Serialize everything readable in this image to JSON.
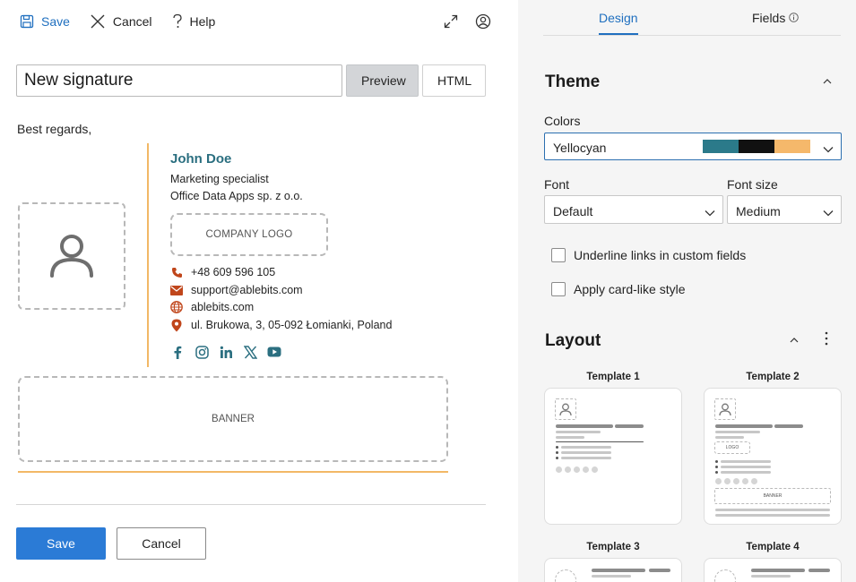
{
  "toolbar": {
    "save_label": "Save",
    "cancel_label": "Cancel",
    "help_label": "Help"
  },
  "editor": {
    "signature_name": "New signature",
    "preview_label": "Preview",
    "html_label": "HTML",
    "greeting": "Best regards,"
  },
  "signature": {
    "name": "John Doe",
    "title": "Marketing specialist",
    "company": "Office Data Apps sp. z o.o.",
    "logo_placeholder": "COMPANY LOGO",
    "phone": "+48 609 596 105",
    "email": "support@ablebits.com",
    "website": "ablebits.com",
    "address": "ul. Brukowa, 3, 05-092 Łomianki, Poland",
    "banner_placeholder": "BANNER",
    "accent_color": "#f2b866",
    "name_color": "#2b6f80"
  },
  "footer": {
    "save_label": "Save",
    "cancel_label": "Cancel"
  },
  "panel": {
    "tabs": [
      {
        "label": "Design"
      },
      {
        "label": "Fields"
      }
    ],
    "theme": {
      "title": "Theme",
      "colors_label": "Colors",
      "colors_value": "Yellocyan",
      "swatches": [
        "#2b7a8a",
        "#111111",
        "#f5b86b"
      ],
      "font_label": "Font",
      "font_value": "Default",
      "font_size_label": "Font size",
      "font_size_value": "Medium",
      "underline_label": "Underline links in custom fields",
      "card_label": "Apply card-like style"
    },
    "layout": {
      "title": "Layout",
      "templates": [
        {
          "label": "Template 1",
          "logo": "",
          "banner": ""
        },
        {
          "label": "Template 2",
          "logo": "LOGO",
          "banner": "BANNER"
        },
        {
          "label": "Template 3"
        },
        {
          "label": "Template 4"
        }
      ]
    }
  }
}
